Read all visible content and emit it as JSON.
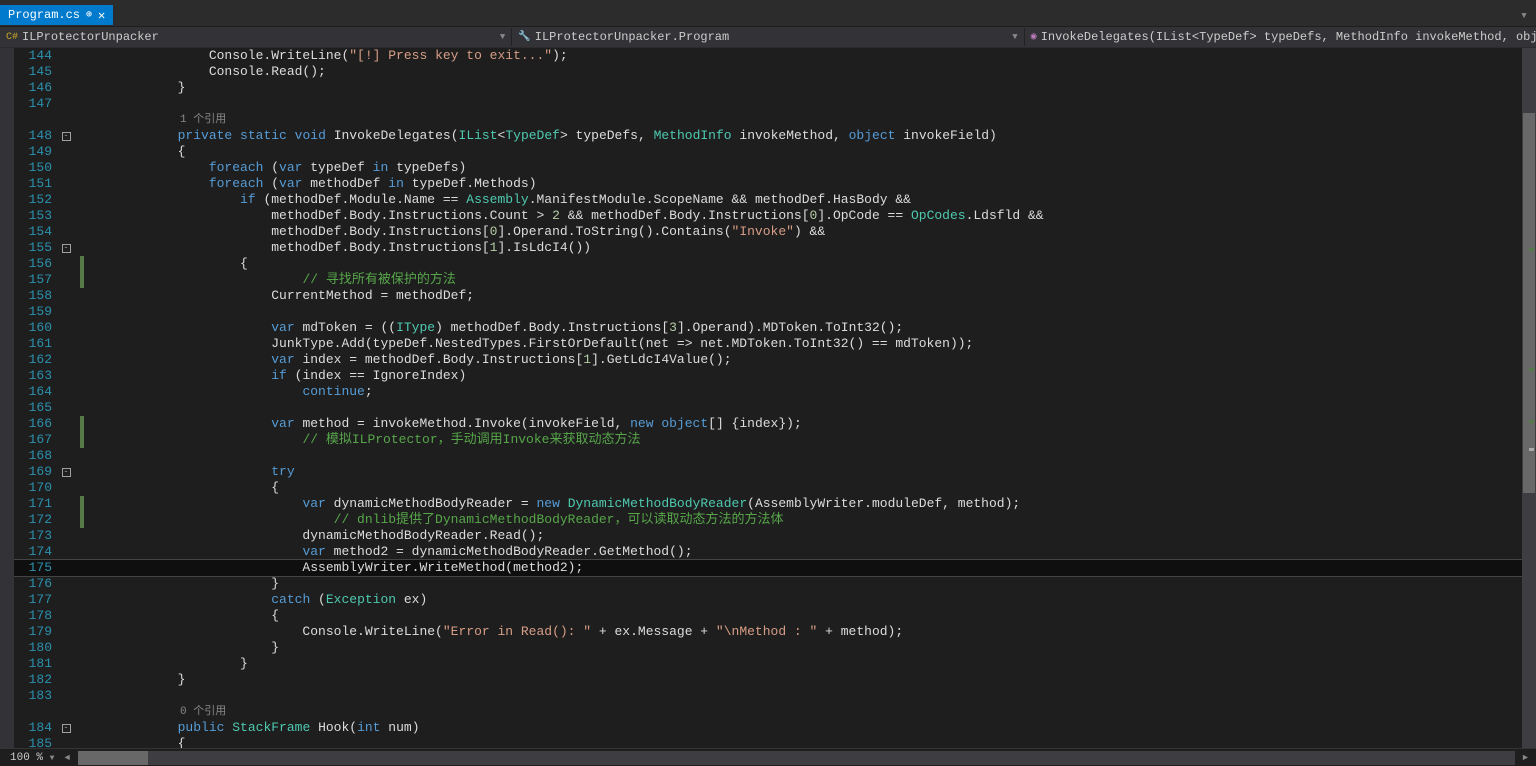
{
  "tab": {
    "filename": "Program.cs",
    "pinned": true
  },
  "nav": {
    "namespace": "ILProtectorUnpacker",
    "class": "ILProtectorUnpacker.Program",
    "method": "InvokeDelegates(IList<TypeDef> typeDefs, MethodInfo invokeMethod, object inv"
  },
  "codelens": {
    "ref1": "1 个引用",
    "ref0": "0 个引用"
  },
  "zoom": "100 %",
  "lines": [
    {
      "n": 144,
      "chg": "",
      "out": "",
      "t": "                Console.WriteLine(~s\"[!] Press key to exit...\"~);"
    },
    {
      "n": 145,
      "chg": "",
      "out": "",
      "t": "                Console.Read();"
    },
    {
      "n": 146,
      "chg": "",
      "out": "",
      "t": "            }"
    },
    {
      "n": 147,
      "chg": "",
      "out": "",
      "t": ""
    },
    {
      "codelens": "ref1",
      "indent": "            "
    },
    {
      "n": 148,
      "chg": "",
      "out": "-",
      "t": "            ~kprivate~ ~kstatic~ ~kvoid~ InvokeDelegates(~tIList~<~tTypeDef~> typeDefs, ~tMethodInfo~ invokeMethod, ~kobject~ invokeField)"
    },
    {
      "n": 149,
      "chg": "",
      "out": "",
      "t": "            {"
    },
    {
      "n": 150,
      "chg": "",
      "out": "",
      "t": "                ~kforeach~ (~kvar~ typeDef ~kin~ typeDefs)"
    },
    {
      "n": 151,
      "chg": "",
      "out": "",
      "t": "                ~kforeach~ (~kvar~ methodDef ~kin~ typeDef.Methods)"
    },
    {
      "n": 152,
      "chg": "",
      "out": "",
      "t": "                    ~kif~ (methodDef.Module.Name == ~tAssembly~.ManifestModule.ScopeName && methodDef.HasBody &&"
    },
    {
      "n": 153,
      "chg": "",
      "out": "",
      "t": "                        methodDef.Body.Instructions.Count > ~n2~ && methodDef.Body.Instructions[~n0~].OpCode == ~tOpCodes~.Ldsfld &&"
    },
    {
      "n": 154,
      "chg": "",
      "out": "",
      "t": "                        methodDef.Body.Instructions[~n0~].Operand.ToString().Contains(~s\"Invoke\"~) &&"
    },
    {
      "n": 155,
      "chg": "",
      "out": "-",
      "t": "                        methodDef.Body.Instructions[~n1~].IsLdcI4())"
    },
    {
      "n": 156,
      "chg": "g",
      "out": "",
      "t": "                    {"
    },
    {
      "n": 157,
      "chg": "g",
      "out": "",
      "t": "                            ~c// 寻找所有被保护的方法~"
    },
    {
      "n": 158,
      "chg": "",
      "out": "",
      "t": "                        CurrentMethod = methodDef;"
    },
    {
      "n": 159,
      "chg": "",
      "out": "",
      "t": ""
    },
    {
      "n": 160,
      "chg": "",
      "out": "",
      "t": "                        ~kvar~ mdToken = ((~tIType~) methodDef.Body.Instructions[~n3~].Operand).MDToken.ToInt32();"
    },
    {
      "n": 161,
      "chg": "",
      "out": "",
      "t": "                        JunkType.Add(typeDef.NestedTypes.FirstOrDefault(net => net.MDToken.ToInt32() == mdToken));"
    },
    {
      "n": 162,
      "chg": "",
      "out": "",
      "t": "                        ~kvar~ index = methodDef.Body.Instructions[~n1~].GetLdcI4Value();"
    },
    {
      "n": 163,
      "chg": "",
      "out": "",
      "t": "                        ~kif~ (index == IgnoreIndex)"
    },
    {
      "n": 164,
      "chg": "",
      "out": "",
      "t": "                            ~kcontinue~;"
    },
    {
      "n": 165,
      "chg": "",
      "out": "",
      "t": ""
    },
    {
      "n": 166,
      "chg": "g",
      "out": "",
      "t": "                        ~kvar~ method = invokeMethod.Invoke(invokeField, ~knew~ ~kobject~[] {index});"
    },
    {
      "n": 167,
      "chg": "g",
      "out": "",
      "t": "                            ~c// 模拟ILProtector，手动调用Invoke来获取动态方法~"
    },
    {
      "n": 168,
      "chg": "",
      "out": "",
      "t": ""
    },
    {
      "n": 169,
      "chg": "",
      "out": "-",
      "t": "                        ~ktry~"
    },
    {
      "n": 170,
      "chg": "",
      "out": "",
      "t": "                        {"
    },
    {
      "n": 171,
      "chg": "g",
      "out": "",
      "t": "                            ~kvar~ dynamicMethodBodyReader = ~knew~ ~tDynamicMethodBodyReader~(AssemblyWriter.moduleDef, method);"
    },
    {
      "n": 172,
      "chg": "g",
      "out": "",
      "t": "                                ~c// dnlib提供了DynamicMethodBodyReader，可以读取动态方法的方法体~"
    },
    {
      "n": 173,
      "chg": "",
      "out": "",
      "t": "                            dynamicMethodBodyReader.Read();"
    },
    {
      "n": 174,
      "chg": "",
      "out": "",
      "t": "                            ~kvar~ method2 = dynamicMethodBodyReader.GetMethod();"
    },
    {
      "n": 175,
      "chg": "",
      "out": "",
      "t": "                            AssemblyWriter.WriteMethod(method2);",
      "current": true
    },
    {
      "n": 176,
      "chg": "",
      "out": "",
      "t": "                        }"
    },
    {
      "n": 177,
      "chg": "",
      "out": "",
      "t": "                        ~kcatch~ (~tException~ ex)"
    },
    {
      "n": 178,
      "chg": "",
      "out": "",
      "t": "                        {"
    },
    {
      "n": 179,
      "chg": "",
      "out": "",
      "t": "                            Console.WriteLine(~s\"Error in Read(): \"~ + ex.Message + ~s\"\\nMethod : \"~ + method);"
    },
    {
      "n": 180,
      "chg": "",
      "out": "",
      "t": "                        }"
    },
    {
      "n": 181,
      "chg": "",
      "out": "",
      "t": "                    }"
    },
    {
      "n": 182,
      "chg": "",
      "out": "",
      "t": "            }"
    },
    {
      "n": 183,
      "chg": "",
      "out": "",
      "t": ""
    },
    {
      "codelens": "ref0",
      "indent": "            "
    },
    {
      "n": 184,
      "chg": "",
      "out": "-",
      "t": "            ~kpublic~ ~tStackFrame~ Hook(~kint~ num)"
    },
    {
      "n": 185,
      "chg": "",
      "out": "",
      "t": "            {"
    }
  ]
}
